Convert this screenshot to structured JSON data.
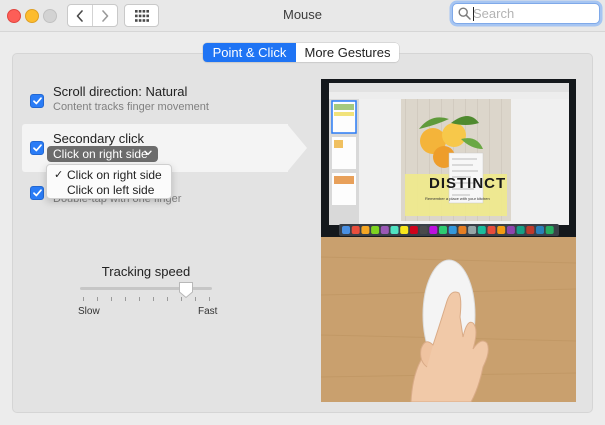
{
  "window": {
    "title": "Mouse",
    "controls": [
      "close",
      "minimize",
      "zoom"
    ],
    "nav_icons": [
      "chevron-left-icon",
      "chevron-right-icon",
      "grid-icon"
    ]
  },
  "search": {
    "placeholder": "Search",
    "value": ""
  },
  "tabs": [
    {
      "label": "Point & Click",
      "active": true
    },
    {
      "label": "More Gestures",
      "active": false
    }
  ],
  "options": {
    "scroll_direction": {
      "title": "Scroll direction: Natural",
      "subtitle": "Content tracks finger movement",
      "checked": true
    },
    "secondary_click": {
      "title": "Secondary click",
      "selected_value": "Click on right side",
      "checked": true,
      "menu": [
        {
          "label": "Click on right side",
          "checked": true
        },
        {
          "label": "Click on left side",
          "checked": false
        }
      ]
    },
    "smart_zoom": {
      "subtitle": "Double-tap with one finger",
      "checked": true
    }
  },
  "tracking_speed": {
    "label": "Tracking speed",
    "min_label": "Slow",
    "max_label": "Fast",
    "value": 0.8,
    "tick_count": 10
  },
  "preview": {
    "poster_headline": "DISTINCT",
    "poster_tagline": "Remember a place with your kitchen"
  },
  "colors": {
    "accent": "#1f74f4",
    "checkbox": "#2a7cf6",
    "close": "#fd5e57",
    "minimize": "#fdbc2e"
  }
}
